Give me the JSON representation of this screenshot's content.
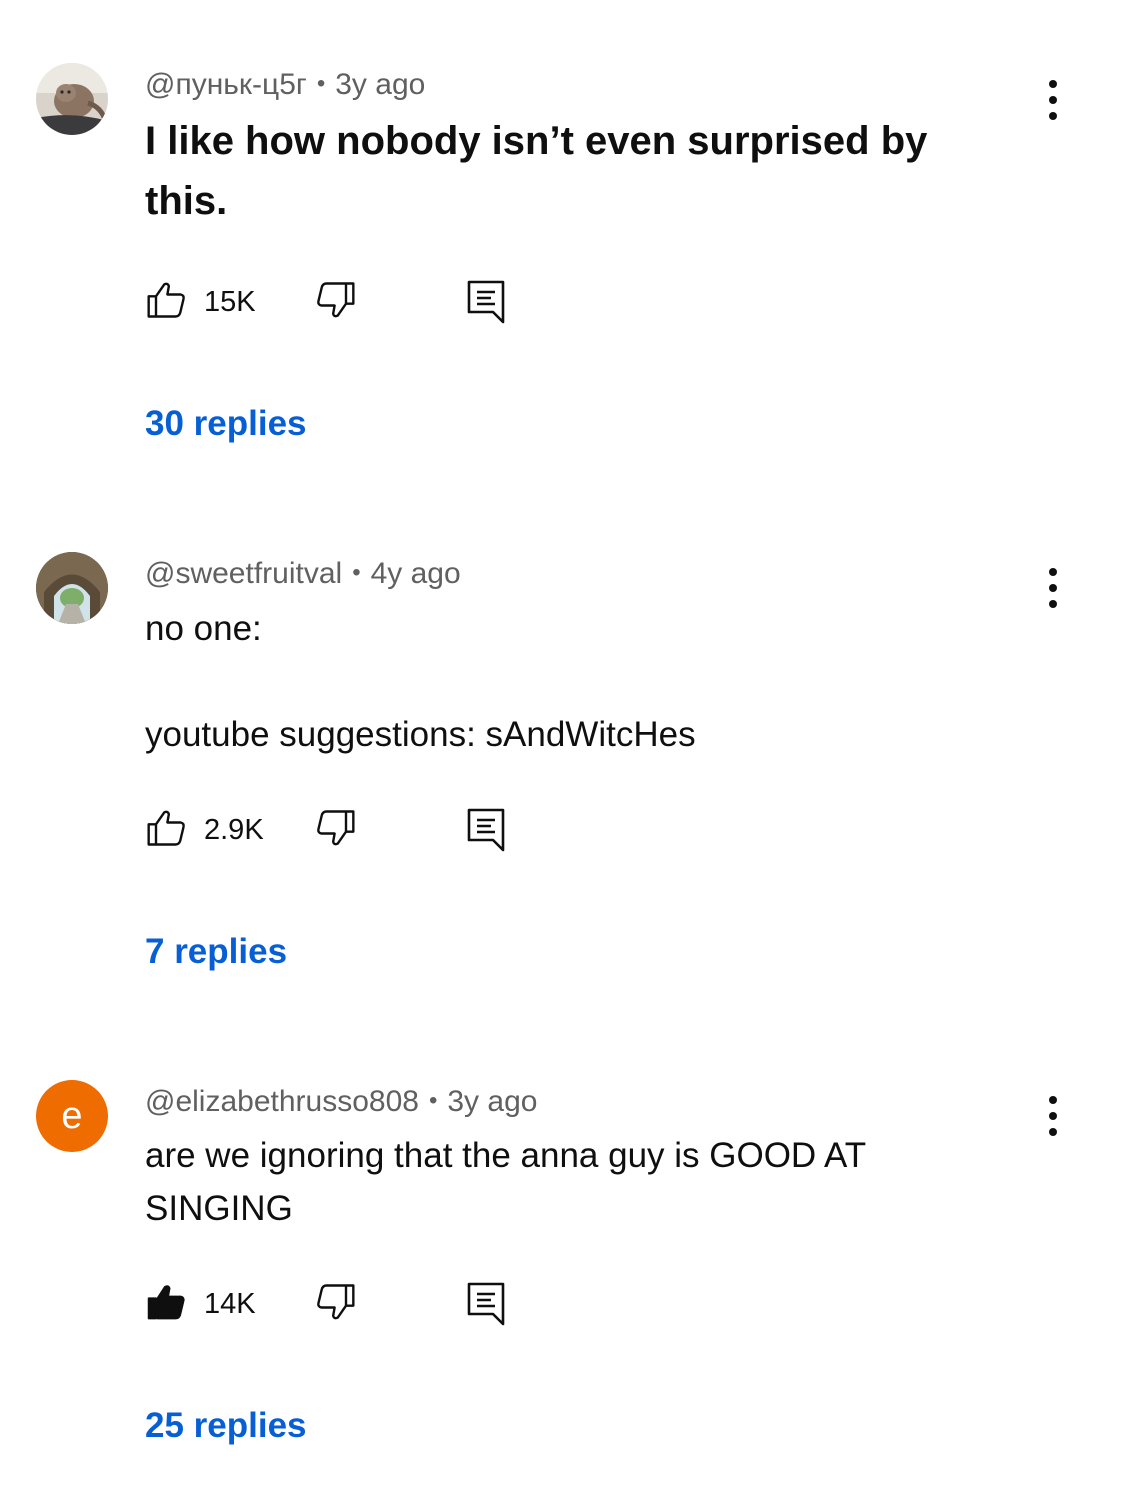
{
  "comments": [
    {
      "author": "@пуньк-ц5г",
      "time": "3y ago",
      "text": "I like how nobody isn’t even surprised by this.",
      "likes": "15K",
      "liked": false,
      "replies": "30 replies",
      "avatar": "photo-cat"
    },
    {
      "author": "@sweetfruitval",
      "time": "4y ago",
      "text_line1": "no one:",
      "text_line2": "youtube suggestions: sAndWitcHes",
      "likes": "2.9K",
      "liked": false,
      "replies": "7 replies",
      "avatar": "photo-tunnel"
    },
    {
      "author": "@elizabethrusso808",
      "time": "3y ago",
      "text": "are we ignoring that the anna guy is GOOD AT SINGING",
      "likes": "14K",
      "liked": true,
      "replies": "25 replies",
      "avatar_letter": "e",
      "avatar_color": "#ef6c00"
    }
  ],
  "separator": "•",
  "colors": {
    "link": "#065fd4",
    "meta": "#606060",
    "text": "#0f0f0f"
  },
  "icons": [
    "thumbs-up-icon",
    "thumbs-down-icon",
    "reply-icon",
    "more-vert-icon"
  ]
}
